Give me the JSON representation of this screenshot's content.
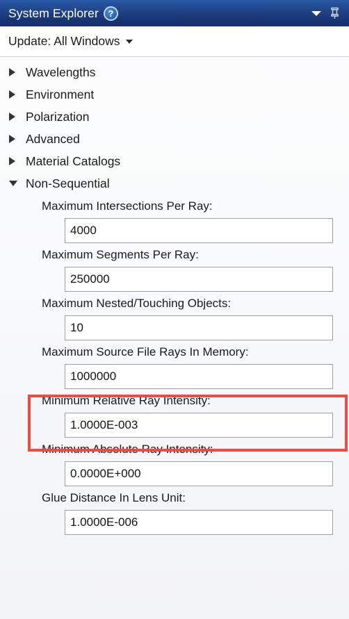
{
  "titlebar": {
    "title": "System Explorer",
    "help_icon": "help-question-icon",
    "help_glyph": "?",
    "dropdown_icon": "chevron-down-icon",
    "pin_icon": "pin-icon",
    "background_color": "#1d4183",
    "text_color": "#ffffff"
  },
  "toolbar": {
    "update_label": "Update: All Windows",
    "caret_icon": "caret-down-icon"
  },
  "tree": {
    "items": [
      {
        "label": "Wavelengths",
        "expanded": false,
        "icon": "triangle-right-icon"
      },
      {
        "label": "Environment",
        "expanded": false,
        "icon": "triangle-right-icon"
      },
      {
        "label": "Polarization",
        "expanded": false,
        "icon": "triangle-right-icon"
      },
      {
        "label": "Advanced",
        "expanded": false,
        "icon": "triangle-right-icon"
      },
      {
        "label": "Material Catalogs",
        "expanded": false,
        "icon": "triangle-right-icon"
      },
      {
        "label": "Non-Sequential",
        "expanded": true,
        "icon": "triangle-down-icon"
      }
    ]
  },
  "fields": [
    {
      "label": "Maximum Intersections Per Ray:",
      "value": "4000",
      "highlighted": false
    },
    {
      "label": "Maximum Segments Per Ray:",
      "value": "250000",
      "highlighted": false
    },
    {
      "label": "Maximum Nested/Touching Objects:",
      "value": "10",
      "highlighted": false
    },
    {
      "label": "Maximum Source File Rays In Memory:",
      "value": "1000000",
      "highlighted": false
    },
    {
      "label": "Minimum Relative Ray Intensity:",
      "value": "1.0000E-003",
      "highlighted": true
    },
    {
      "label": "Minimum Absolute Ray Intensity:",
      "value": "0.0000E+000",
      "highlighted": false
    },
    {
      "label": "Glue Distance In Lens Unit:",
      "value": "1.0000E-006",
      "highlighted": false
    }
  ],
  "annotation": {
    "color": "#ee4a46",
    "target_field_label": "Minimum Relative Ray Intensity:"
  }
}
